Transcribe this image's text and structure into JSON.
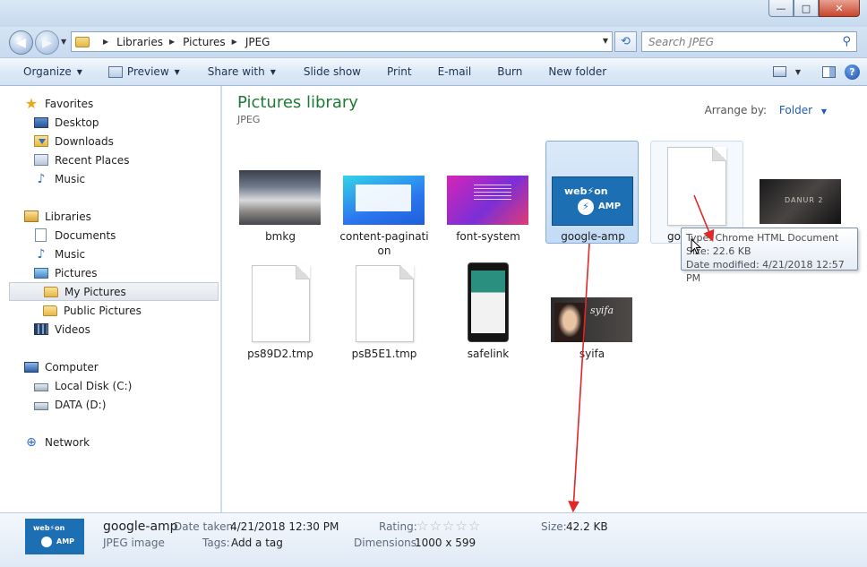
{
  "window": {
    "min": "—",
    "max": "□",
    "close": "✕"
  },
  "address": {
    "crumbs": [
      "Libraries",
      "Pictures",
      "JPEG"
    ],
    "search_placeholder": "Search JPEG"
  },
  "toolbar": {
    "organize": "Organize",
    "preview": "Preview",
    "share_with": "Share with",
    "slide_show": "Slide show",
    "print": "Print",
    "email": "E-mail",
    "burn": "Burn",
    "new_folder": "New folder",
    "help": "?"
  },
  "nav": {
    "favorites": "Favorites",
    "desktop": "Desktop",
    "downloads": "Downloads",
    "recent_places": "Recent Places",
    "music_fav": "Music",
    "libraries": "Libraries",
    "documents": "Documents",
    "music_lib": "Music",
    "pictures": "Pictures",
    "my_pictures": "My Pictures",
    "public_pictures": "Public Pictures",
    "videos": "Videos",
    "computer": "Computer",
    "local_disk": "Local Disk (C:)",
    "data_disk": "DATA (D:)",
    "network": "Network"
  },
  "content": {
    "title": "Pictures library",
    "subtitle": "JPEG",
    "arrange_label": "Arrange by:",
    "arrange_value": "Folder",
    "files": [
      {
        "name": "bmkg"
      },
      {
        "name": "content-paginati on"
      },
      {
        "name": "font-system"
      },
      {
        "name": "google-amp"
      },
      {
        "name": "go"
      },
      {
        "name": ""
      },
      {
        "name": "ps89D2.tmp"
      },
      {
        "name": "psB5E1.tmp"
      },
      {
        "name": "safelink"
      },
      {
        "name": "syifa"
      }
    ],
    "amp_logo": "web⚡on",
    "amp_word": "AMP",
    "danur_logo": "DANUR 2"
  },
  "tooltip": {
    "type": "Type: Chrome HTML Document",
    "size": "Size: 22.6 KB",
    "modified": "Date modified: 4/21/2018 12:57 PM"
  },
  "details": {
    "name": "google-amp",
    "kind": "JPEG image",
    "date_taken_label": "Date taken:",
    "date_taken": "4/21/2018 12:30 PM",
    "tags_label": "Tags:",
    "tags": "Add a tag",
    "rating_label": "Rating:",
    "rating": 0,
    "dimensions_label": "Dimensions:",
    "dimensions": "1000 x 599",
    "size_label": "Size:",
    "size": "42.2 KB"
  },
  "colors": {
    "library_title": "#1e7b35",
    "link_blue": "#1f5bb3",
    "annotation_red": "#e0282a"
  }
}
